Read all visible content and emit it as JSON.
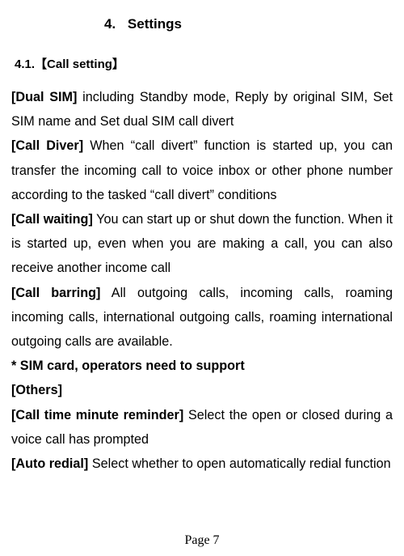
{
  "chapter": {
    "number": "4.",
    "title": "Settings"
  },
  "section": {
    "number": "4.1.",
    "title_bracket_open": "【",
    "title_text": "Call setting",
    "title_bracket_close": "】"
  },
  "body": {
    "dual_sim_label": "[Dual SIM]",
    "dual_sim_text": " including Standby mode, Reply by original SIM, Set SIM name and Set dual SIM call divert",
    "call_diver_label": "[Call Diver]",
    "call_diver_text": " When “call divert” function is started up, you can transfer the incoming call to voice inbox or other phone number according to the tasked “call divert” conditions",
    "call_waiting_label": "[Call waiting]",
    "call_waiting_text": " You can start up or shut down the function. When it is started up, even when you are making a call, you can also receive another income call",
    "call_barring_label": "[Call barring]",
    "call_barring_text": " All outgoing calls, incoming calls, roaming incoming calls, international outgoing calls, roaming international outgoing calls are available.",
    "sim_note": "* SIM card, operators need to support",
    "others_label": "[Others]",
    "minute_reminder_label": "[Call time minute reminder]",
    "minute_reminder_text": " Select the open or closed during a voice call has prompted",
    "auto_redial_label": "[Auto redial]",
    "auto_redial_text": " Select whether to open automatically redial function"
  },
  "footer": {
    "page_label": "Page 7"
  }
}
